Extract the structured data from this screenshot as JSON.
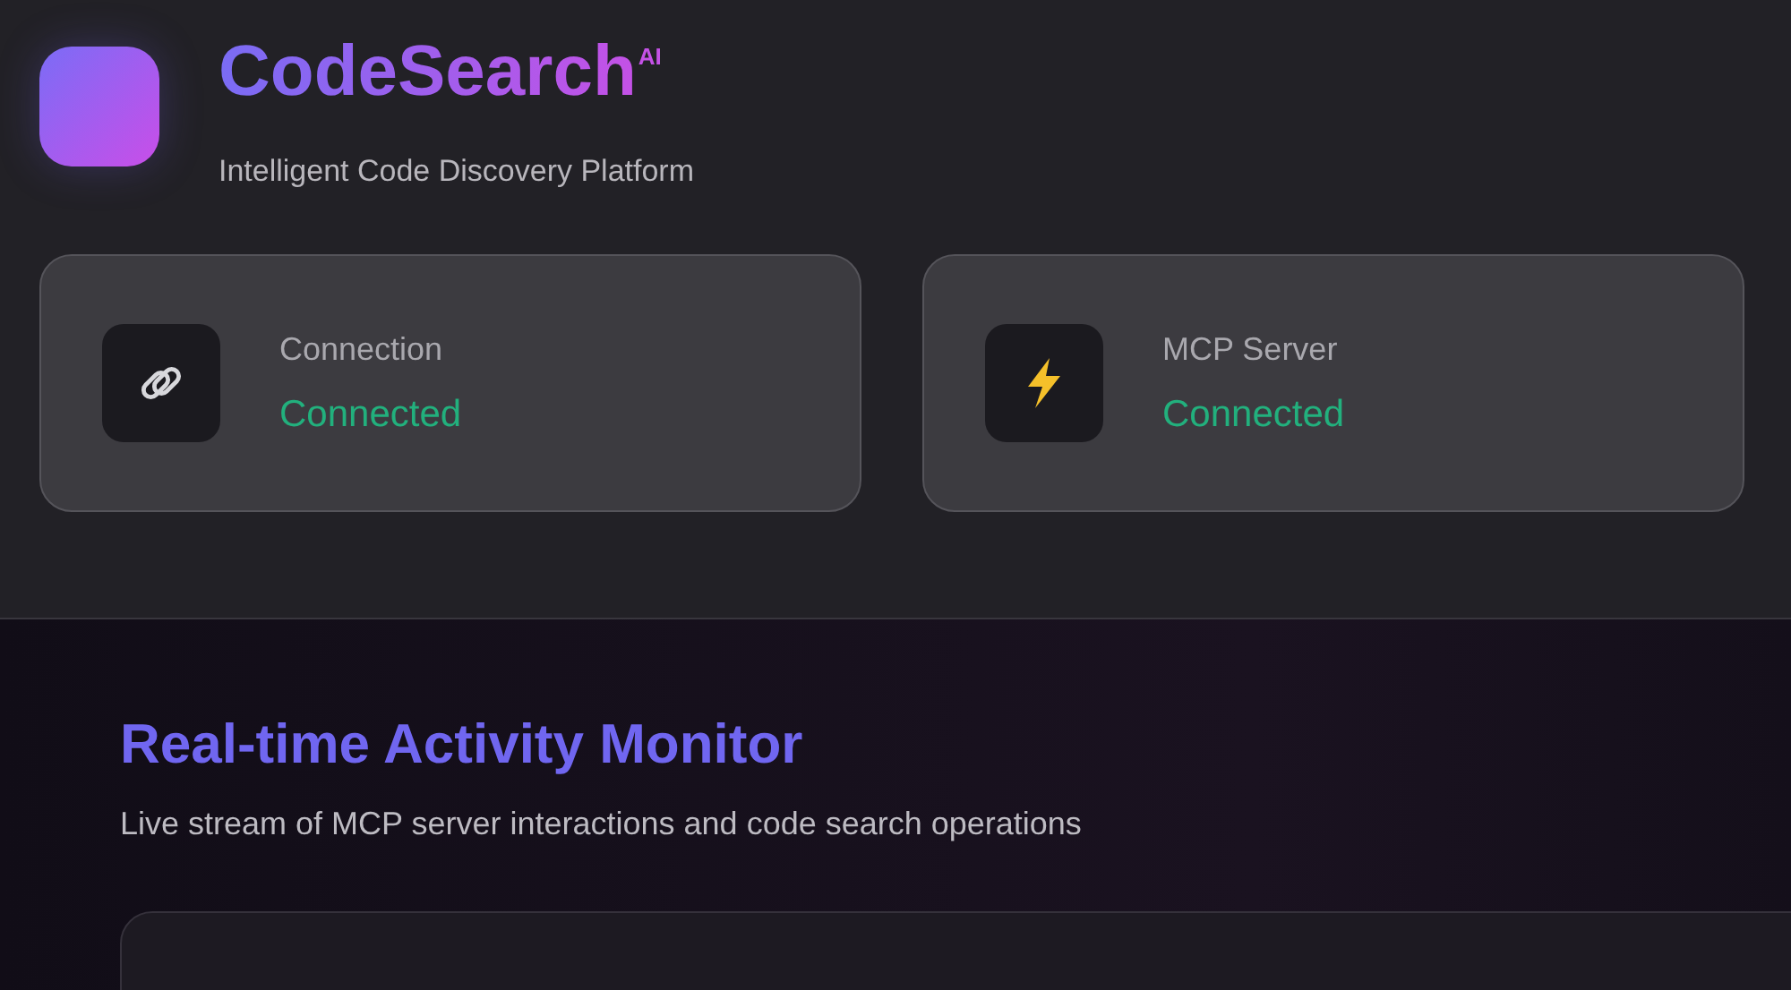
{
  "brand": {
    "name": "CodeSearch",
    "badge": "AI",
    "tagline": "Intelligent Code Discovery Platform"
  },
  "status_cards": [
    {
      "kind": "link",
      "label": "Connection",
      "status": "Connected",
      "color": "#22b07d"
    },
    {
      "kind": "bolt",
      "label": "MCP Server",
      "status": "Connected",
      "color": "#22b07d"
    }
  ],
  "activity": {
    "title": "Real-time Activity Monitor",
    "description": "Live stream of MCP server interactions and code search operations"
  }
}
